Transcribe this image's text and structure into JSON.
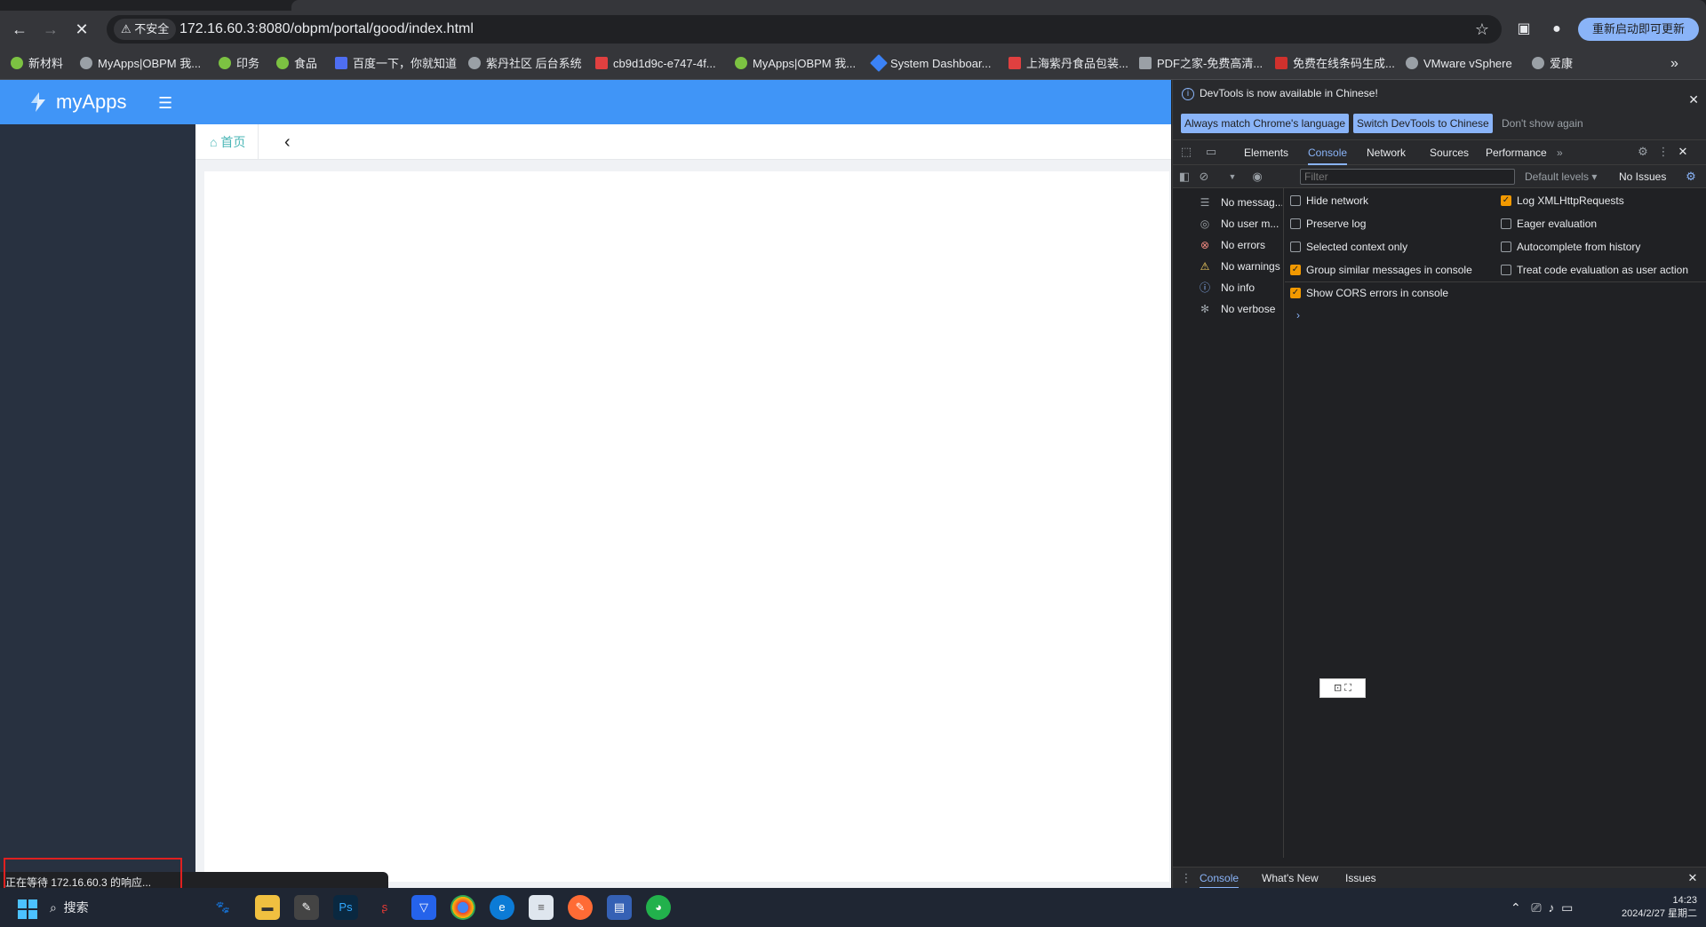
{
  "browser": {
    "security_label": "⚠ 不安全",
    "url": "172.16.60.3:8080/obpm/portal/good/index.html",
    "update_button": "重新启动即可更新",
    "bookmarks": [
      "新材料",
      "MyApps|OBPM 我...",
      "印务",
      "食品",
      "百度一下，你就知道",
      "紫丹社区 后台系统",
      "cb9d1d9c-e747-4f...",
      "MyApps|OBPM 我...",
      "System Dashboar...",
      "上海紫丹食品包装...",
      "PDF之家-免费高清...",
      "免费在线条码生成...",
      "VMware vSphere",
      "爱康"
    ],
    "bookmarks_more": "»"
  },
  "app": {
    "name": "myApps",
    "home_crumb": "首页",
    "back_glyph": "‹"
  },
  "status": {
    "text": "正在等待 172.16.60.3 的响应..."
  },
  "devtools": {
    "notice": "DevTools is now available in Chinese!",
    "btn_match": "Always match Chrome's language",
    "btn_switch": "Switch DevTools to Chinese",
    "btn_dismiss": "Don't show again",
    "tabs": [
      "Elements",
      "Console",
      "Network",
      "Sources",
      "Performance"
    ],
    "more_tabs": "»",
    "filter_placeholder": "Filter",
    "levels": "Default levels ▾",
    "issues": "No Issues",
    "sidebar": [
      "No messag...",
      "No user m...",
      "No errors",
      "No warnings",
      "No info",
      "No verbose"
    ],
    "options_left": [
      {
        "label": "Hide network",
        "checked": false
      },
      {
        "label": "Preserve log",
        "checked": false
      },
      {
        "label": "Selected context only",
        "checked": false
      },
      {
        "label": "Group similar messages in console",
        "checked": true
      },
      {
        "label": "Show CORS errors in console",
        "checked": true
      }
    ],
    "options_right": [
      {
        "label": "Log XMLHttpRequests",
        "checked": true
      },
      {
        "label": "Eager evaluation",
        "checked": false
      },
      {
        "label": "Autocomplete from history",
        "checked": false
      },
      {
        "label": "Treat code evaluation as user action",
        "checked": false
      }
    ],
    "prompt": "›",
    "drawer_tabs": [
      "Console",
      "What's New",
      "Issues"
    ]
  },
  "taskbar": {
    "search": "搜索",
    "time": "14:23",
    "date": "2024/2/27 星期二"
  },
  "colors": {
    "app_header": "#4095f7",
    "app_sidebar": "#283140",
    "accent": "#8ab4f8",
    "checkbox_on": "#f29900"
  }
}
